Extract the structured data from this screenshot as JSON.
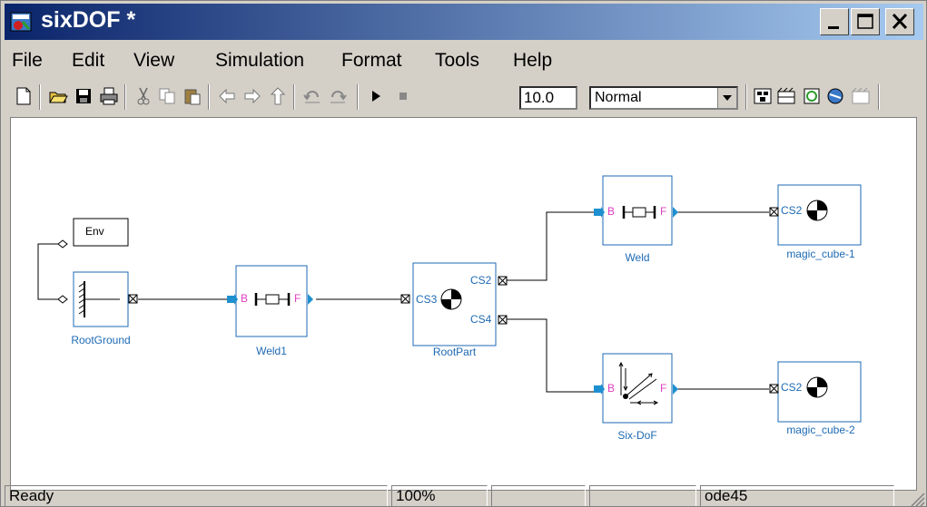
{
  "window": {
    "title": "sixDOF *"
  },
  "menu": [
    "File",
    "Edit",
    "View",
    "Simulation",
    "Format",
    "Tools",
    "Help"
  ],
  "toolbar": {
    "stop_time": "10.0",
    "sim_mode": "Normal"
  },
  "blocks": {
    "env": "Env",
    "root_ground": "RootGround",
    "weld1": "Weld1",
    "root_part": "RootPart",
    "weld": "Weld",
    "six_dof": "Six-DoF",
    "magic_cube_1": "magic_cube-1",
    "magic_cube_2": "magic_cube-2"
  },
  "ports": {
    "b": "B",
    "f": "F",
    "cs2": "CS2",
    "cs3": "CS3",
    "cs4": "CS4"
  },
  "status": {
    "state": "Ready",
    "zoom": "100%",
    "solver": "ode45"
  },
  "colors": {
    "title_start": "#0a246a",
    "title_end": "#a6caf0",
    "block_border": "#1e6ab4",
    "port_blue": "#1e90d0",
    "port_pink": "#e040c0"
  }
}
